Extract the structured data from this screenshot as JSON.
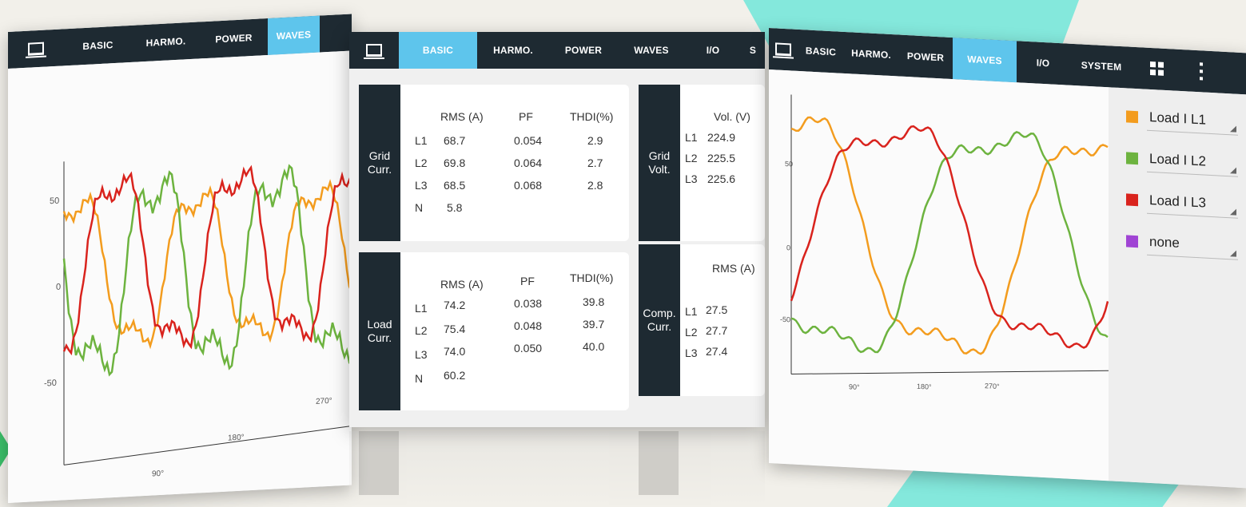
{
  "left_panel": {
    "nav": [
      "BASIC",
      "HARMO.",
      "POWER",
      "WAVES"
    ],
    "active": "WAVES",
    "y_ticks": [
      "50",
      "0",
      "-50"
    ],
    "x_ticks": [
      "90°",
      "180°",
      "270°"
    ],
    "series_colors": {
      "l1": "#f39c1e",
      "l2": "#6db33f",
      "l3": "#d9231d"
    }
  },
  "middle_panel": {
    "nav": [
      "BASIC",
      "HARMO.",
      "POWER",
      "WAVES",
      "I/O",
      "S"
    ],
    "active": "BASIC",
    "grid_curr": {
      "label": [
        "Grid",
        "Curr."
      ],
      "headers": [
        "RMS (A)",
        "PF",
        "THDI(%)"
      ],
      "rows": [
        {
          "phase": "L1",
          "rms": "68.7",
          "pf": "0.054",
          "thdi": "2.9"
        },
        {
          "phase": "L2",
          "rms": "69.8",
          "pf": "0.064",
          "thdi": "2.7"
        },
        {
          "phase": "L3",
          "rms": "68.5",
          "pf": "0.068",
          "thdi": "2.8"
        },
        {
          "phase": "N",
          "rms": "5.8",
          "pf": "",
          "thdi": ""
        }
      ]
    },
    "grid_volt": {
      "label": [
        "Grid",
        "Volt."
      ],
      "header": "Vol. (V)",
      "rows": [
        {
          "phase": "L1",
          "value": "224.9"
        },
        {
          "phase": "L2",
          "value": "225.5"
        },
        {
          "phase": "L3",
          "value": "225.6"
        }
      ]
    },
    "load_curr": {
      "label": [
        "Load",
        "Curr."
      ],
      "headers": [
        "RMS (A)",
        "PF",
        "THDI(%)"
      ],
      "rows": [
        {
          "phase": "L1",
          "rms": "74.2",
          "pf": "0.038",
          "thdi": "39.8"
        },
        {
          "phase": "L2",
          "rms": "75.4",
          "pf": "0.048",
          "thdi": "39.7"
        },
        {
          "phase": "L3",
          "rms": "74.0",
          "pf": "0.050",
          "thdi": "40.0"
        },
        {
          "phase": "N",
          "rms": "60.2",
          "pf": "",
          "thdi": ""
        }
      ]
    },
    "comp_curr": {
      "label": [
        "Comp.",
        "Curr."
      ],
      "header": "RMS (A)",
      "rows": [
        {
          "phase": "L1",
          "value": "27.5"
        },
        {
          "phase": "L2",
          "value": "27.7"
        },
        {
          "phase": "L3",
          "value": "27.4"
        }
      ]
    }
  },
  "right_panel": {
    "nav": [
      "BASIC",
      "HARMO.",
      "POWER",
      "WAVES",
      "I/O",
      "SYSTEM"
    ],
    "active": "WAVES",
    "y_ticks": [
      "50",
      "0",
      "-50"
    ],
    "x_ticks": [
      "90°",
      "180°",
      "270°"
    ],
    "legend": [
      {
        "label": "Load I L1",
        "color": "#f39c1e"
      },
      {
        "label": "Load I L2",
        "color": "#6db33f"
      },
      {
        "label": "Load I L3",
        "color": "#d9231d"
      },
      {
        "label": "none",
        "color": "#a044d4"
      }
    ]
  }
}
